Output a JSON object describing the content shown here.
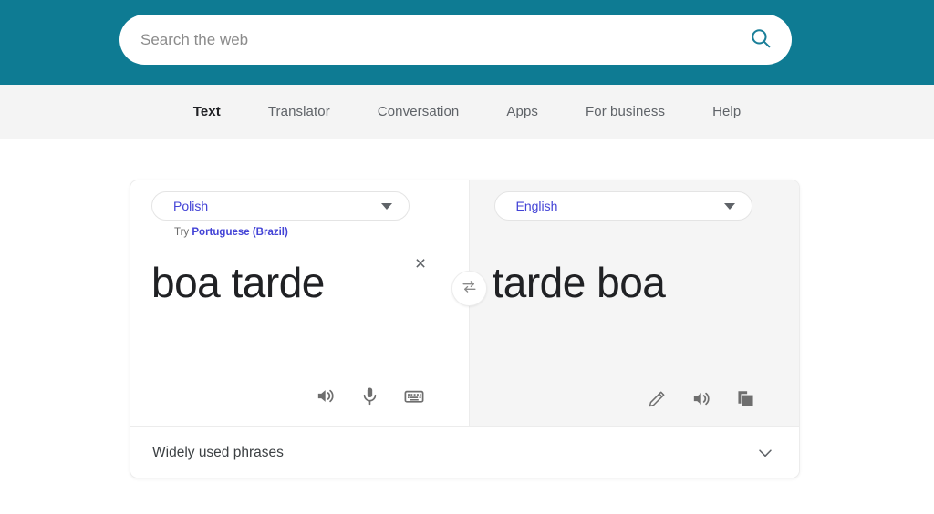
{
  "header": {
    "search": {
      "placeholder": "Search the web",
      "value": "",
      "icon": "search-icon"
    },
    "background_color": "#0e7b93"
  },
  "nav": {
    "items": [
      {
        "label": "Text",
        "active": true
      },
      {
        "label": "Translator",
        "active": false
      },
      {
        "label": "Conversation",
        "active": false
      },
      {
        "label": "Apps",
        "active": false
      },
      {
        "label": "For business",
        "active": false
      },
      {
        "label": "Help",
        "active": false
      }
    ]
  },
  "translator": {
    "source": {
      "language": "Polish",
      "suggestion_prefix": "Try",
      "suggestion_language": "Portuguese (Brazil)",
      "text": "boa tarde",
      "clear_label": "×",
      "actions": [
        "speaker-icon",
        "microphone-icon",
        "keyboard-icon"
      ]
    },
    "swap": {
      "icon": "swap-arrows-icon"
    },
    "target": {
      "language": "English",
      "text": "tarde boa",
      "actions": [
        "pencil-icon",
        "speaker-icon",
        "copy-icon"
      ]
    },
    "footer": {
      "label": "Widely used phrases",
      "icon": "chevron-down-icon"
    },
    "accent_color": "#4343d6"
  }
}
